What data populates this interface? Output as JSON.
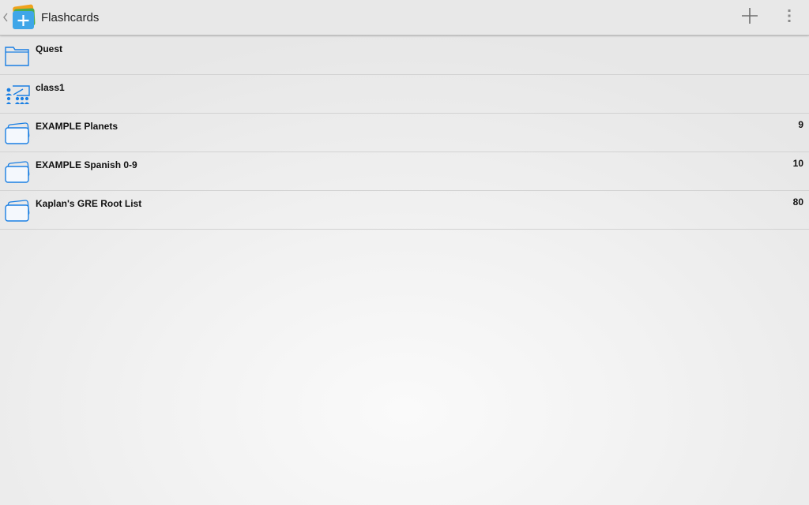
{
  "app": {
    "title": "Flashcards",
    "icon_name": "flashcards-app-icon",
    "accent_color": "#1a7fe3"
  },
  "actions": [
    {
      "name": "add-icon"
    },
    {
      "name": "overflow-menu-icon"
    }
  ],
  "items": [
    {
      "label": "Quest",
      "count": "",
      "icon": "folder-icon"
    },
    {
      "label": "class1",
      "count": "",
      "icon": "class-icon"
    },
    {
      "label": "EXAMPLE Planets",
      "count": "9",
      "icon": "deck-icon"
    },
    {
      "label": "EXAMPLE Spanish 0-9",
      "count": "10",
      "icon": "deck-icon"
    },
    {
      "label": "Kaplan's GRE Root List",
      "count": "80",
      "icon": "deck-icon"
    }
  ]
}
